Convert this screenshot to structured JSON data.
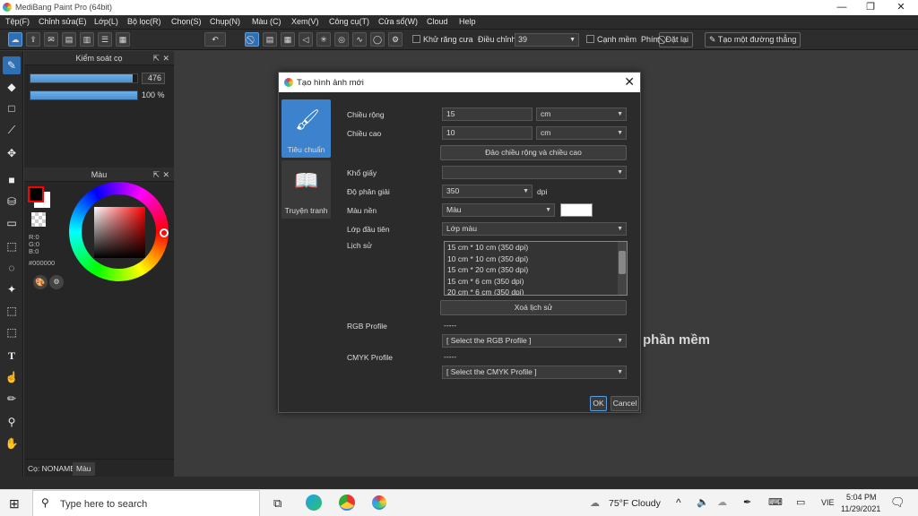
{
  "app": {
    "title": "MediBang Paint Pro (64bit)",
    "window_controls": [
      "—",
      "❐",
      "✕"
    ]
  },
  "menu": [
    "Tệp(F)",
    "Chỉnh sửa(E)",
    "Lớp(L)",
    "Bộ lọc(R)",
    "Chọn(S)",
    "Chụp(N)",
    "Màu (C)",
    "Xem(V)",
    "Công cụ(T)",
    "Cửa sổ(W)",
    "Cloud",
    "Help"
  ],
  "toolbar": {
    "antialias_label": "Khử răng cưa",
    "adjust_label": "Điều chỉnh",
    "adjust_value": "39",
    "soft_edge_label": "Cạnh mềm",
    "key_label": "Phím",
    "reset_label": "Đặt lại",
    "straight_line_label": "Tạo một đường thẳng"
  },
  "brush_panel": {
    "title": "Kiểm soát cọ",
    "size_value": "476",
    "size_fraction": 0.96,
    "opacity_value": "100 %",
    "opacity_fraction": 1.0
  },
  "color_panel": {
    "title": "Màu",
    "r": "R:0",
    "g": "G:0",
    "b": "B:0",
    "hex": "#000000",
    "foreground": "#000000",
    "background": "#ffffff",
    "primary_border": "#ff0000"
  },
  "bottom_tabs": [
    "Cọ: NONAME",
    "Màu"
  ],
  "workspace": {
    "background_text": "phần mềm"
  },
  "dialog": {
    "title": "Tạo hình ảnh mới",
    "categories": [
      {
        "label": "Tiêu chuẩn",
        "icon": "brush-icon",
        "selected": true
      },
      {
        "label": "Truyện tranh",
        "icon": "book-icon",
        "selected": false
      }
    ],
    "width_label": "Chiều rộng",
    "width_value": "15",
    "width_unit": "cm",
    "height_label": "Chiều cao",
    "height_value": "10",
    "height_unit": "cm",
    "swap_button": "Đảo chiều rộng và chiều cao",
    "paper_label": "Khổ giấy",
    "paper_value": "",
    "resolution_label": "Độ phân giải",
    "resolution_value": "350",
    "resolution_unit": "dpi",
    "bg_color_label": "Màu nền",
    "bg_color_value": "Màu",
    "bg_color_swatch": "#ffffff",
    "first_layer_label": "Lớp đầu tiên",
    "first_layer_value": "Lớp màu",
    "history_label": "Lịch sử",
    "history_items": [
      "15 cm * 10 cm (350 dpi)",
      "10 cm * 10 cm (350 dpi)",
      "15 cm * 20 cm (350 dpi)",
      "15 cm * 6 cm (350 dpi)",
      "20 cm * 6 cm (350 dpi)"
    ],
    "clear_history_button": "Xoá lịch sử",
    "rgb_profile_label": "RGB Profile",
    "rgb_profile_current": "-----",
    "rgb_profile_select": "[ Select the RGB Profile ]",
    "cmyk_profile_label": "CMYK Profile",
    "cmyk_profile_current": "-----",
    "cmyk_profile_select": "[ Select the CMYK Profile ]",
    "ok_button": "OK",
    "cancel_button": "Cancel"
  },
  "taskbar": {
    "search_placeholder": "Type here to search",
    "weather": "75°F  Cloudy",
    "lang": "VIE",
    "time": "5:04 PM",
    "date": "11/29/2021"
  },
  "colors": {
    "accent": "#2f6fb4",
    "panel_bg": "#262626",
    "workspace_bg": "#3b3b3b"
  }
}
